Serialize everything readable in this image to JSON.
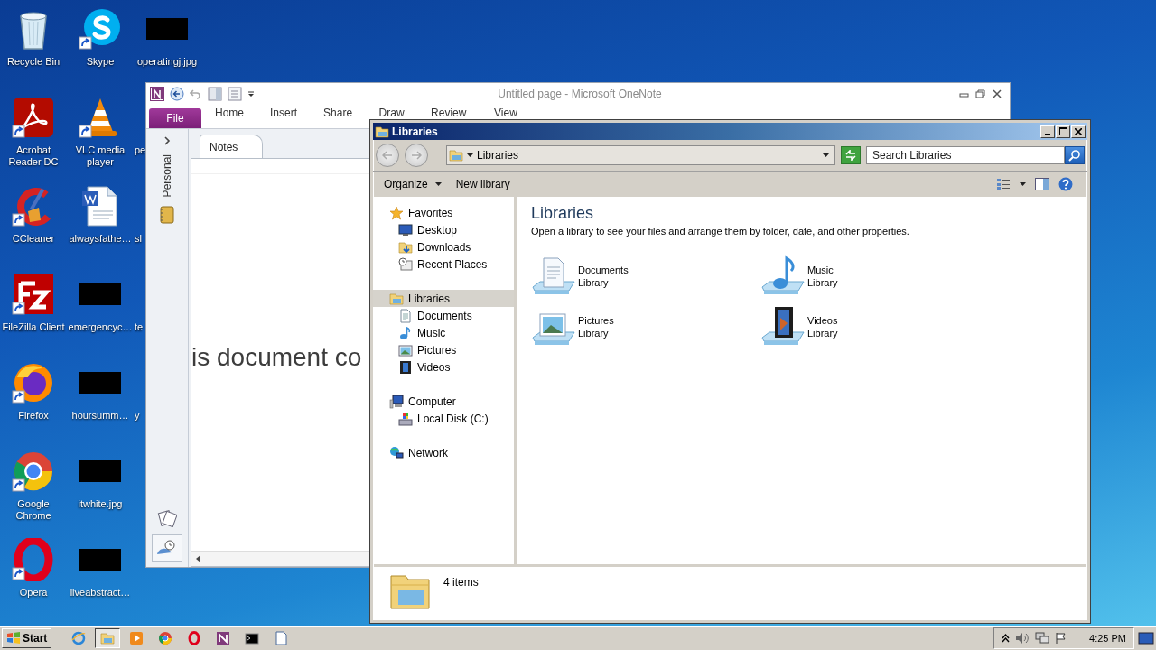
{
  "desktop_icons": [
    {
      "label": "Recycle Bin",
      "kind": "recycle-bin",
      "shortcut": false
    },
    {
      "label": "Acrobat Reader DC",
      "kind": "acrobat",
      "shortcut": true
    },
    {
      "label": "CCleaner",
      "kind": "ccleaner",
      "shortcut": true
    },
    {
      "label": "FileZilla Client",
      "kind": "filezilla",
      "shortcut": true
    },
    {
      "label": "Firefox",
      "kind": "firefox",
      "shortcut": true
    },
    {
      "label": "Google Chrome",
      "kind": "chrome",
      "shortcut": true
    },
    {
      "label": "Opera",
      "kind": "opera",
      "shortcut": true
    },
    {
      "label": "Skype",
      "kind": "skype",
      "shortcut": true
    },
    {
      "label": "VLC media player",
      "kind": "vlc",
      "shortcut": true
    },
    {
      "label": "alwaysfathe…",
      "kind": "word-document",
      "shortcut": false
    },
    {
      "label": "emergencyc…",
      "kind": "redacted",
      "shortcut": false
    },
    {
      "label": "hoursumm…",
      "kind": "redacted",
      "shortcut": false
    },
    {
      "label": "itwhite.jpg",
      "kind": "redacted",
      "shortcut": false
    },
    {
      "label": "liveabstract…",
      "kind": "redacted",
      "shortcut": false
    },
    {
      "label": "operatingj.jpg",
      "kind": "redacted",
      "shortcut": false
    },
    {
      "label": "pe",
      "kind": "covered",
      "shortcut": false
    },
    {
      "label": "sl",
      "kind": "covered",
      "shortcut": false
    },
    {
      "label": "te",
      "kind": "covered",
      "shortcut": false
    },
    {
      "label": "y",
      "kind": "covered",
      "shortcut": false
    }
  ],
  "onenote": {
    "title": "Untitled page  -  Microsoft OneNote",
    "ribbon_tabs": [
      {
        "label": "File",
        "kind": "file"
      },
      {
        "label": "Home",
        "kind": "tab"
      },
      {
        "label": "Insert",
        "kind": "tab"
      },
      {
        "label": "Share",
        "kind": "tab"
      },
      {
        "label": "Draw",
        "kind": "tab"
      },
      {
        "label": "Review",
        "kind": "tab"
      },
      {
        "label": "View",
        "kind": "tab"
      }
    ],
    "notebook": "Personal",
    "section_tabs": [
      {
        "label": "Notes",
        "selected": true
      }
    ],
    "page_text": "is document co"
  },
  "explorer": {
    "title": "Libraries",
    "address": "Libraries",
    "search": {
      "placeholder": "Search Libraries"
    },
    "commands": [
      {
        "label": "Organize",
        "menu": true
      },
      {
        "label": "New library",
        "menu": false
      }
    ],
    "nav": [
      {
        "label": "Favorites",
        "kind": "star",
        "selected": false,
        "children": [
          {
            "label": "Desktop",
            "kind": "desktop",
            "selected": false
          },
          {
            "label": "Downloads",
            "kind": "downloads",
            "selected": false
          },
          {
            "label": "Recent Places",
            "kind": "recent",
            "selected": false
          }
        ]
      },
      {
        "label": "Libraries",
        "kind": "library",
        "selected": true,
        "children": [
          {
            "label": "Documents",
            "kind": "document",
            "selected": false
          },
          {
            "label": "Music",
            "kind": "music",
            "selected": false
          },
          {
            "label": "Pictures",
            "kind": "picture",
            "selected": false
          },
          {
            "label": "Videos",
            "kind": "video",
            "selected": false
          }
        ]
      },
      {
        "label": "Computer",
        "kind": "computer",
        "selected": false,
        "children": [
          {
            "label": "Local Disk (C:)",
            "kind": "disk",
            "selected": false
          }
        ]
      },
      {
        "label": "Network",
        "kind": "network",
        "selected": false
      }
    ],
    "heading": "Libraries",
    "description": "Open a library to see your files and arrange them by folder, date, and other properties.",
    "libraries": [
      {
        "name": "Documents",
        "type": "Library",
        "kind": "document"
      },
      {
        "name": "Music",
        "type": "Library",
        "kind": "music"
      },
      {
        "name": "Pictures",
        "type": "Library",
        "kind": "picture"
      },
      {
        "name": "Videos",
        "type": "Library",
        "kind": "video"
      }
    ],
    "status": "4 items"
  },
  "taskbar": {
    "start": "Start",
    "buttons": [
      {
        "kind": "ie",
        "selected": false
      },
      {
        "kind": "explorer",
        "selected": true
      },
      {
        "kind": "media",
        "selected": false
      },
      {
        "kind": "chrome",
        "selected": false
      },
      {
        "kind": "opera",
        "selected": false
      },
      {
        "kind": "onenote",
        "selected": false
      },
      {
        "kind": "console",
        "selected": false
      },
      {
        "kind": "notepad",
        "selected": false
      }
    ],
    "clock": "4:25 PM"
  }
}
